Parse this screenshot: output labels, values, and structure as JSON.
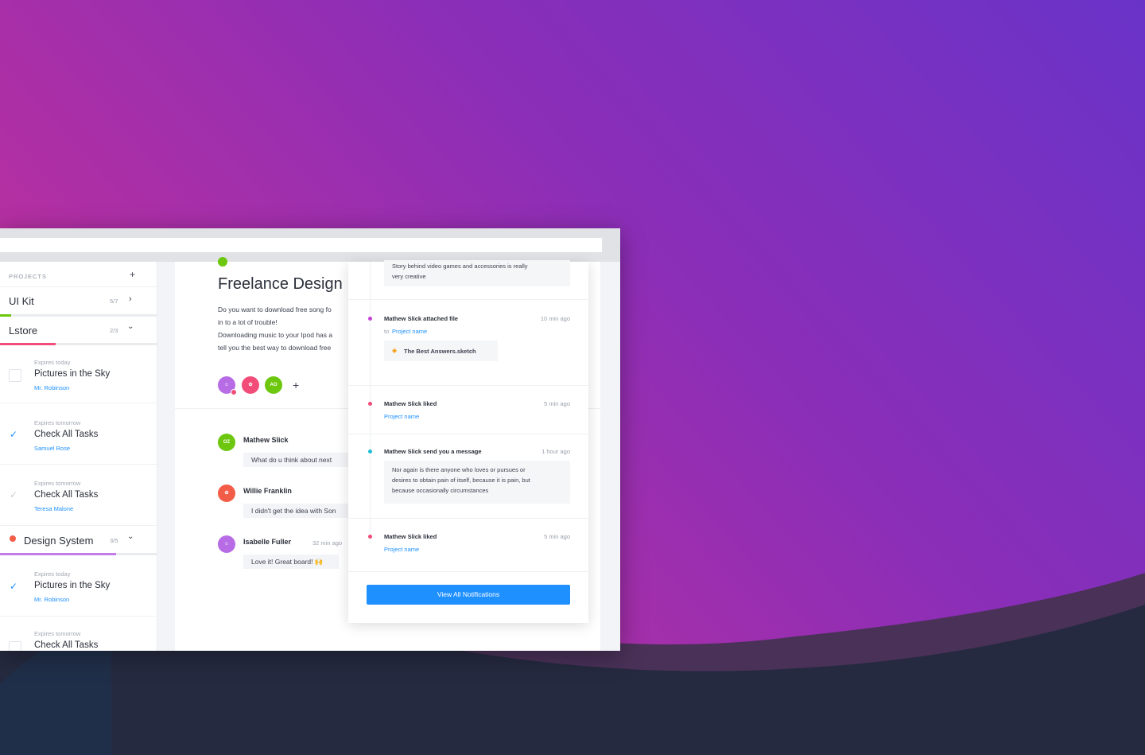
{
  "colors": {
    "accent": "#1e90ff",
    "green": "#6cc70e",
    "pink": "#f24d79",
    "purple": "#b76ce6",
    "red": "#f35c47",
    "teal": "#1bbfd3",
    "magenta": "#c840d8"
  },
  "sidebar": {
    "section_heading": "PROJECTS",
    "add_icon": "plus-icon",
    "projects": [
      {
        "title": "UI Kit",
        "count": "5/7",
        "progress": 0.07,
        "color": "#6cc70e"
      },
      {
        "title": "Lstore",
        "count": "2/3",
        "progress": 0.36,
        "color": "#f24d79"
      },
      {
        "title": "Design System",
        "count": "3/5",
        "progress": 0.74,
        "color": "#c27ce9"
      }
    ],
    "tasks_lstore": [
      {
        "expires": "Expires today",
        "name": "Pictures in the Sky",
        "user": "Mr. Robinson",
        "done": false
      },
      {
        "expires": "Expires tomorrow",
        "name": "Check All Tasks",
        "user": "Samuel Rose",
        "done": true
      },
      {
        "expires": "Expires tomorrow",
        "name": "Check All Tasks",
        "user": "Teresa Malone",
        "done": true
      }
    ],
    "tasks_design": [
      {
        "expires": "Expires today",
        "name": "Pictures in the Sky",
        "user": "Mr. Robinson",
        "done": true
      },
      {
        "expires": "Expires tomorrow",
        "name": "Check All Tasks",
        "user": "",
        "done": false
      }
    ]
  },
  "main": {
    "title": "Freelance Design",
    "description": [
      "Do you want to download free song fo",
      "in to a lot of trouble!",
      "Downloading music to your Ipod has a",
      "tell you the best way to download free"
    ],
    "members": [
      "avatar-1",
      "avatar-2",
      "AO"
    ],
    "comments": [
      {
        "initials": "OZ",
        "name": "Mathew Slick",
        "time": "",
        "text": "What do u think about next"
      },
      {
        "initials": "",
        "name": "Willie Franklin",
        "time": "",
        "text": "I didn't get the idea with Son"
      },
      {
        "initials": "",
        "name": "Isabelle Fuller",
        "time": "32 min ago",
        "text": "Love it! Great board! 🙌"
      }
    ]
  },
  "notifications": {
    "top_message": [
      "Story behind video games and accessories is really",
      "very creative"
    ],
    "items": [
      {
        "title": "Mathew Slick attached file",
        "time": "10 min ago",
        "prefix": "to",
        "link": "Project name",
        "file": "The Best Answers.sketch"
      },
      {
        "title": "Mathew Slick liked",
        "time": "5 min ago",
        "link": "Project name"
      },
      {
        "title": "Mathew Slick send you a message",
        "time": "1 hour ago",
        "message": [
          "Nor again is there anyone who loves or pursues or",
          "desires to obtain pain of itself, because it is pain, but",
          "because occasionally circumstances"
        ]
      },
      {
        "title": "Mathew Slick liked",
        "time": "5 min ago",
        "link": "Project name"
      }
    ],
    "button_label": "View All Notifications"
  }
}
